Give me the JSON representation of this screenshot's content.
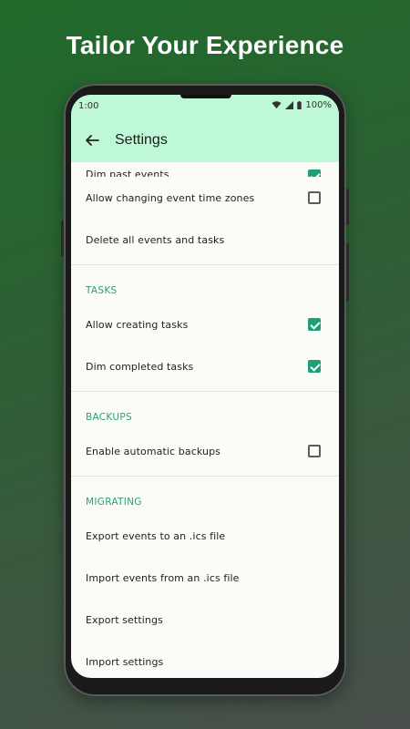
{
  "promo": {
    "title": "Tailor Your Experience"
  },
  "status": {
    "time": "1:00",
    "battery": "100%"
  },
  "appbar": {
    "title": "Settings"
  },
  "events": {
    "partial_item": {
      "label": "Dim past events",
      "checked": true
    },
    "items": [
      {
        "label": "Allow changing event time zones",
        "checked": false
      },
      {
        "label": "Delete all events and tasks"
      }
    ]
  },
  "tasks": {
    "title": "TASKS",
    "items": [
      {
        "label": "Allow creating tasks",
        "checked": true
      },
      {
        "label": "Dim completed tasks",
        "checked": true
      }
    ]
  },
  "backups": {
    "title": "BACKUPS",
    "items": [
      {
        "label": "Enable automatic backups",
        "checked": false
      }
    ]
  },
  "migrating": {
    "title": "MIGRATING",
    "items": [
      {
        "label": "Export events to an .ics file"
      },
      {
        "label": "Import events from an .ics file"
      },
      {
        "label": "Export settings"
      },
      {
        "label": "Import settings"
      }
    ]
  },
  "colors": {
    "accent": "#1f9e77",
    "appbar": "#bff8d6",
    "section": "#2aa273"
  }
}
